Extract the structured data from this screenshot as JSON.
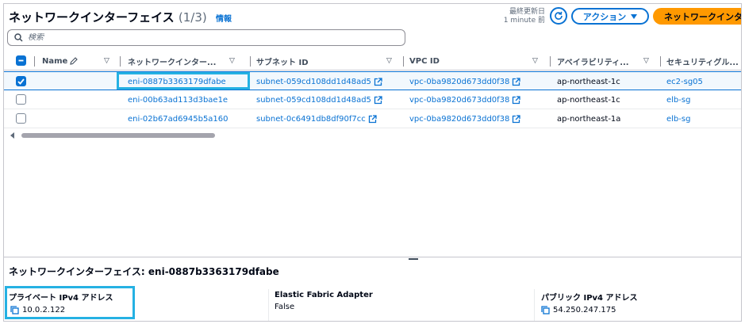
{
  "header": {
    "title": "ネットワークインターフェイス",
    "count": "(1/3)",
    "info_label": "情報",
    "last_updated_label": "最終更新日",
    "last_updated_value": "1 minute 前",
    "action_label": "アクション",
    "create_label": "ネットワークインタ"
  },
  "search": {
    "placeholder": "検索"
  },
  "columns": {
    "name": "Name",
    "eni": "ネットワークインター...",
    "subnet": "サブネット ID",
    "vpc": "VPC ID",
    "az": "アベイラビリティ...",
    "sg": "セキュリティグル..."
  },
  "rows": [
    {
      "name": "",
      "eni": "eni-0887b3363179dfabe",
      "subnet": "subnet-059cd108dd1d48ad5",
      "vpc": "vpc-0ba9820d673dd0f38",
      "az": "ap-northeast-1c",
      "sg": "ec2-sg05",
      "selected": true
    },
    {
      "name": "",
      "eni": "eni-00b63ad113d3bae1e",
      "subnet": "subnet-059cd108dd1d48ad5",
      "vpc": "vpc-0ba9820d673dd0f38",
      "az": "ap-northeast-1c",
      "sg": "elb-sg",
      "selected": false
    },
    {
      "name": "",
      "eni": "eni-02b67ad6945b5a160",
      "subnet": "subnet-0c6491db8df90f7cc",
      "vpc": "vpc-0ba9820d673dd0f38",
      "az": "ap-northeast-1a",
      "sg": "elb-sg",
      "selected": false
    }
  ],
  "details": {
    "title": "ネットワークインターフェイス: eni-0887b3363179dfabe",
    "private_ipv4_label": "プライベート IPv4 アドレス",
    "private_ipv4_value": "10.0.2.122",
    "efa_label": "Elastic Fabric Adapter",
    "efa_value": "False",
    "public_ipv4_label": "パブリック IPv4 アドレス",
    "public_ipv4_value": "54.250.247.175"
  },
  "colors": {
    "accent": "#0972d3",
    "primary_button": "#ff9900",
    "highlight": "#25b1e3",
    "selected_row": "#f2f8fd"
  }
}
